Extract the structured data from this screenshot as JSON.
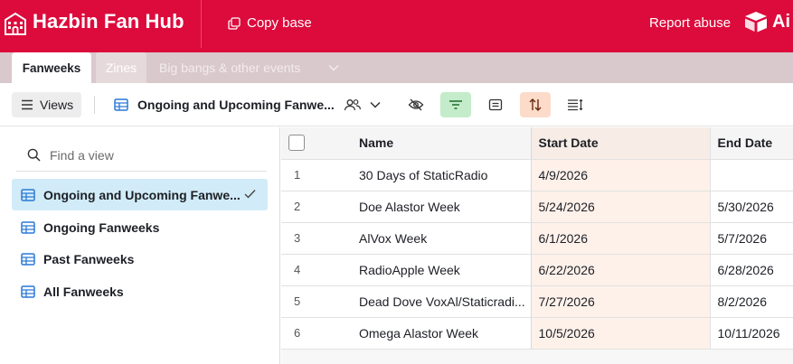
{
  "header": {
    "title": "Hazbin Fan Hub",
    "copy_base": "Copy base",
    "report_abuse": "Report abuse",
    "brand_word": "Ai",
    "bg_color": "#dc0b3c"
  },
  "tabs": [
    {
      "label": "Fanweeks",
      "active": true
    },
    {
      "label": "Zines",
      "active": false
    },
    {
      "label": "Big bangs & other events",
      "active": false
    }
  ],
  "toolbar": {
    "views_label": "Views",
    "current_view": "Ongoing and Upcoming Fanwe...",
    "filter_active_color": "#c4ecca",
    "sort_active_color": "#fcdbca"
  },
  "sidebar": {
    "search_placeholder": "Find a view",
    "views": [
      {
        "label": "Ongoing and Upcoming Fanwe...",
        "active": true
      },
      {
        "label": "Ongoing Fanweeks",
        "active": false
      },
      {
        "label": "Past Fanweeks",
        "active": false
      },
      {
        "label": "All Fanweeks",
        "active": false
      }
    ]
  },
  "table": {
    "columns": [
      "Name",
      "Start Date",
      "End Date"
    ],
    "rows": [
      {
        "index": "1",
        "name": "30 Days of StaticRadio",
        "start": "4/9/2026",
        "end": ""
      },
      {
        "index": "2",
        "name": "Doe Alastor Week",
        "start": "5/24/2026",
        "end": "5/30/2026"
      },
      {
        "index": "3",
        "name": "AlVox Week",
        "start": "6/1/2026",
        "end": "5/7/2026"
      },
      {
        "index": "4",
        "name": "RadioApple Week",
        "start": "6/22/2026",
        "end": "6/28/2026"
      },
      {
        "index": "5",
        "name": "Dead Dove VoxAl/Staticradi...",
        "start": "7/27/2026",
        "end": "8/2/2026"
      },
      {
        "index": "6",
        "name": "Omega Alastor Week",
        "start": "10/5/2026",
        "end": "10/11/2026"
      }
    ]
  }
}
